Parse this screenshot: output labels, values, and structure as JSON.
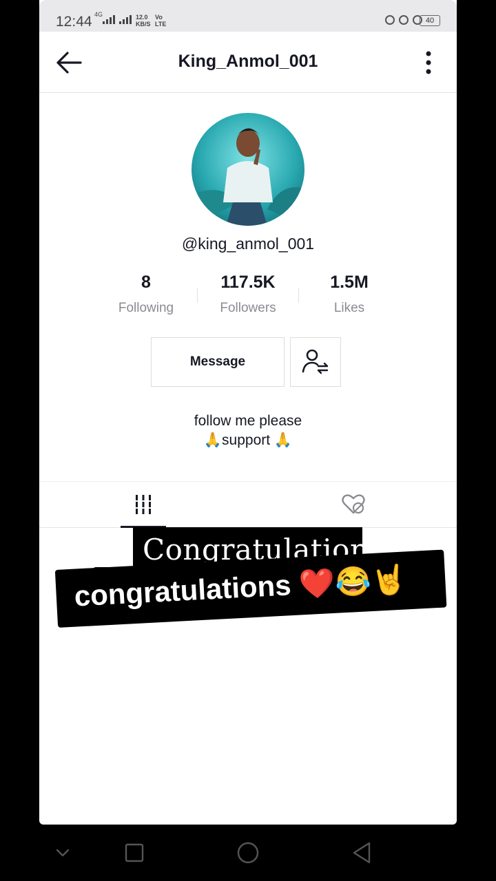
{
  "status_bar": {
    "time": "12:44",
    "network": "4G",
    "speed_value": "12.0",
    "speed_unit": "KB/S",
    "volte_top": "Vo",
    "volte_bottom": "LTE",
    "battery": "40"
  },
  "header": {
    "title": "King_Anmol_001"
  },
  "profile": {
    "username": "@king_anmol_001",
    "stats": [
      {
        "value": "8",
        "label": "Following"
      },
      {
        "value": "117.5K",
        "label": "Followers"
      },
      {
        "value": "1.5M",
        "label": "Likes"
      }
    ],
    "message_button": "Message",
    "bio_line1": "follow me please",
    "bio_line2": "🙏support 🙏"
  },
  "overlay": {
    "sticker_top": "Congratulations",
    "sticker_bottom": "congratulations ❤️😂🤘"
  },
  "colors": {
    "accent_text": "#161823",
    "secondary_text": "#8a8b91",
    "status_bar_bg": "#e9e9ec"
  },
  "icons": {
    "back": "arrow-left-icon",
    "more": "more-vertical-icon",
    "friend": "add-friend-icon",
    "videos_tab": "grid-icon",
    "liked_tab": "hidden-heart-icon"
  }
}
